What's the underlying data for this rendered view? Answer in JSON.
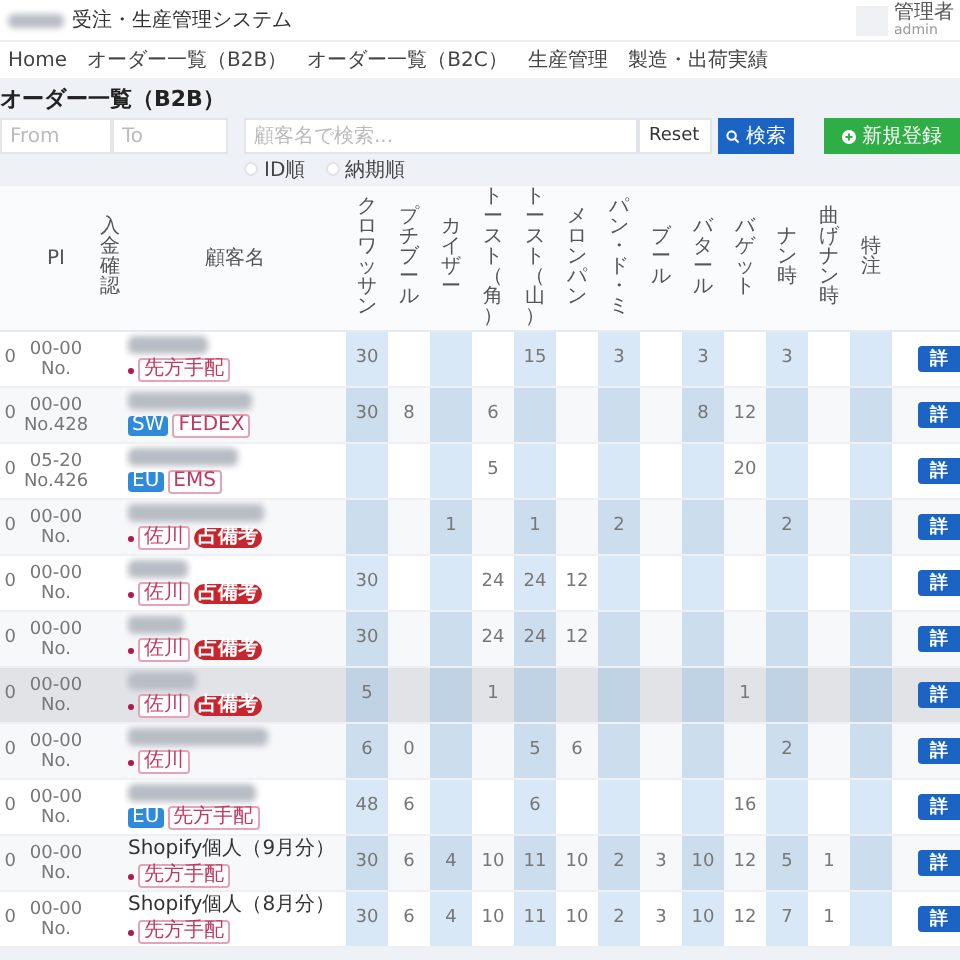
{
  "app_bar": {
    "title": "受注・生産管理システム",
    "user": {
      "role": "管理者",
      "id": "admin"
    }
  },
  "nav": [
    {
      "label": "Home"
    },
    {
      "label": "オーダー一覧（B2B）"
    },
    {
      "label": "オーダー一覧（B2C）"
    },
    {
      "label": "生産管理"
    },
    {
      "label": "製造・出荷実績"
    }
  ],
  "page_title": "オーダー一覧（B2B）",
  "filters": {
    "from": {
      "placeholder": "From"
    },
    "to": {
      "placeholder": "To"
    },
    "search": {
      "placeholder": "顧客名で検索..."
    },
    "reset": "Reset",
    "search_button": "検索",
    "new_button": "新規登録",
    "sort": [
      {
        "label": "ID順",
        "selected": false
      },
      {
        "label": "納期順",
        "selected": false
      }
    ]
  },
  "table": {
    "columns": [
      "PI",
      "入金確認",
      "顧客名",
      "クロワッサン",
      "プチブール",
      "カイザー",
      "トースト（角）",
      "トースト（山）",
      "メロンパン",
      "パン・ド・ミ",
      "ブール",
      "バタール",
      "バゲット",
      "ナン時",
      "曲げナン時",
      "特注"
    ],
    "rows": [
      {
        "column_1": "0",
        "pi": [
          "00-00",
          "No."
        ],
        "redacted": true,
        "dot": true,
        "tags": [
          {
            "kind": "outline",
            "label": "先方手配"
          }
        ],
        "quantities": {
          "col_1": "30",
          "col_5": "15",
          "col_7": "3",
          "col_9": "3",
          "col_11": "3"
        },
        "highlighted": false,
        "action": "詳"
      },
      {
        "column_1": "0",
        "pi": [
          "00-00",
          "No.428"
        ],
        "redacted": true,
        "dot": false,
        "tags": [
          {
            "kind": "region",
            "label": "SW"
          },
          {
            "kind": "outline",
            "label": "FEDEX"
          }
        ],
        "quantities": {
          "col_1": "30",
          "col_2": "8",
          "col_4": "6",
          "col_9": "8",
          "col_10": "12"
        },
        "highlighted": false,
        "action": "詳"
      },
      {
        "column_1": "0",
        "pi": [
          "05-20",
          "No.426"
        ],
        "redacted": true,
        "dot": false,
        "tags": [
          {
            "kind": "region",
            "label": "EU"
          },
          {
            "kind": "outline",
            "label": "EMS"
          }
        ],
        "quantities": {
          "col_4": "5",
          "col_10": "20"
        },
        "highlighted": false,
        "action": "詳"
      },
      {
        "column_1": "0",
        "pi": [
          "00-00",
          "No."
        ],
        "redacted": true,
        "dot": true,
        "tags": [
          {
            "kind": "outline",
            "label": "佐川"
          },
          {
            "kind": "note",
            "label": "占備考"
          }
        ],
        "quantities": {
          "col_3": "1",
          "col_5": "1",
          "col_7": "2",
          "col_11": "2"
        },
        "highlighted": false,
        "action": "詳"
      },
      {
        "column_1": "0",
        "pi": [
          "00-00",
          "No."
        ],
        "redacted": true,
        "dot": true,
        "tags": [
          {
            "kind": "outline",
            "label": "佐川"
          },
          {
            "kind": "note",
            "label": "占備考"
          }
        ],
        "quantities": {
          "col_1": "30",
          "col_4": "24",
          "col_5": "24",
          "col_6": "12"
        },
        "highlighted": false,
        "action": "詳"
      },
      {
        "column_1": "0",
        "pi": [
          "00-00",
          "No."
        ],
        "redacted": true,
        "dot": true,
        "tags": [
          {
            "kind": "outline",
            "label": "佐川"
          },
          {
            "kind": "note",
            "label": "占備考"
          }
        ],
        "quantities": {
          "col_1": "30",
          "col_4": "24",
          "col_5": "24",
          "col_6": "12"
        },
        "highlighted": false,
        "action": "詳"
      },
      {
        "column_1": "0",
        "pi": [
          "00-00",
          "No."
        ],
        "redacted": true,
        "dot": true,
        "tags": [
          {
            "kind": "outline",
            "label": "佐川"
          },
          {
            "kind": "note",
            "label": "占備考"
          }
        ],
        "quantities": {
          "col_1": "5",
          "col_4": "1",
          "col_10": "1"
        },
        "highlighted": true,
        "action": "詳"
      },
      {
        "column_1": "0",
        "pi": [
          "00-00",
          "No."
        ],
        "redacted": true,
        "dot": true,
        "tags": [
          {
            "kind": "outline",
            "label": "佐川"
          }
        ],
        "quantities": {
          "col_1": "6",
          "col_2": "0",
          "col_5": "5",
          "col_6": "6",
          "col_11": "2"
        },
        "highlighted": false,
        "action": "詳"
      },
      {
        "column_1": "0",
        "pi": [
          "00-00",
          "No."
        ],
        "redacted": true,
        "dot": false,
        "tags": [
          {
            "kind": "region",
            "label": "EU"
          },
          {
            "kind": "outline",
            "label": "先方手配"
          }
        ],
        "quantities": {
          "col_1": "48",
          "col_2": "6",
          "col_5": "6",
          "col_10": "16"
        },
        "highlighted": false,
        "action": "詳"
      },
      {
        "column_1": "0",
        "pi": [
          "00-00",
          "No."
        ],
        "name": "Shopify個人（9月分）",
        "dot": true,
        "tags": [
          {
            "kind": "outline",
            "label": "先方手配"
          }
        ],
        "quantities": {
          "col_1": "30",
          "col_2": "6",
          "col_3": "4",
          "col_4": "10",
          "col_5": "11",
          "col_6": "10",
          "col_7": "2",
          "col_8": "3",
          "col_9": "10",
          "col_10": "12",
          "col_11": "5",
          "col_12": "1"
        },
        "highlighted": false,
        "action": "詳"
      },
      {
        "column_1": "0",
        "pi": [
          "00-00",
          "No."
        ],
        "name": "Shopify個人（8月分）",
        "dot": true,
        "tags": [
          {
            "kind": "outline",
            "label": "先方手配"
          }
        ],
        "quantities": {
          "col_1": "30",
          "col_2": "6",
          "col_3": "4",
          "col_4": "10",
          "col_5": "11",
          "col_6": "10",
          "col_7": "2",
          "col_8": "3",
          "col_9": "10",
          "col_10": "12",
          "col_11": "7",
          "col_12": "1"
        },
        "highlighted": false,
        "action": "詳"
      }
    ]
  }
}
